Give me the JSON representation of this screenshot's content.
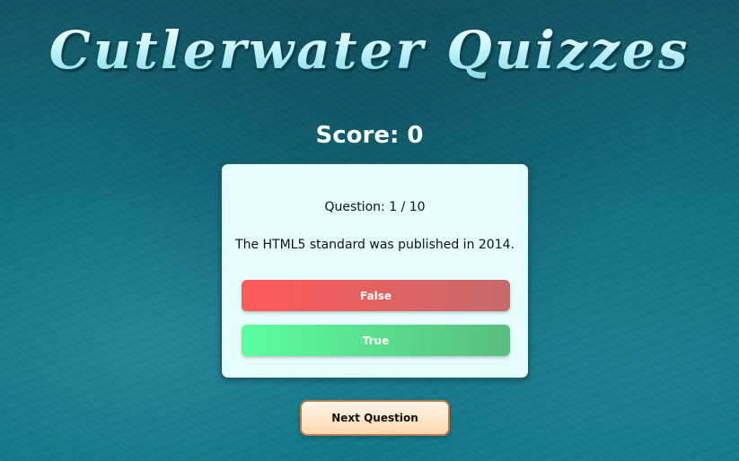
{
  "app": {
    "title": "Cutlerwater Quizzes"
  },
  "score": {
    "text": "Score: 0"
  },
  "question": {
    "number_text": "Question: 1 / 10",
    "text": "The HTML5 standard was published in 2014."
  },
  "answers": [
    {
      "label": "False",
      "color_start": "#ff5a5a",
      "color_end": "#c56a6a"
    },
    {
      "label": "True",
      "color_start": "#5bff9e",
      "color_end": "#58bd7f"
    }
  ],
  "next_button": {
    "label": "Next Question"
  }
}
